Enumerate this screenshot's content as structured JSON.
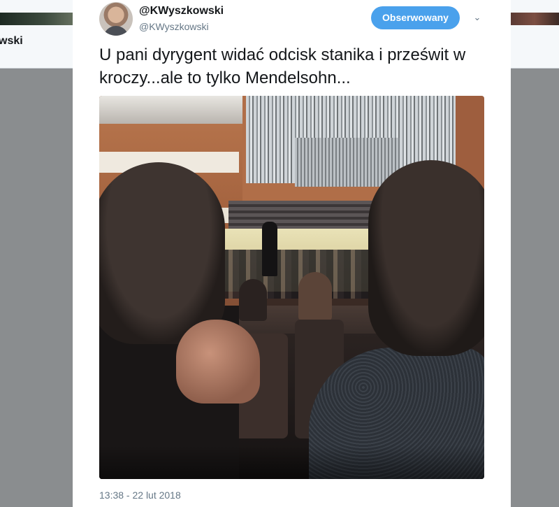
{
  "background": {
    "tab_label": "wski"
  },
  "tweet": {
    "display_name": "@KWyszkowski",
    "username": "@KWyszkowski",
    "follow_label": "Obserwowany",
    "caret": "⌄",
    "text": "U pani dyrygent widać odcisk stanika i prześwit w kroczy...ale to tylko Mendelsohn...",
    "timestamp": "13:38 - 22 lut 2018"
  },
  "colors": {
    "follow_button": "#4aa1ec",
    "secondary_text": "#657786",
    "primary_text": "#14171a"
  }
}
